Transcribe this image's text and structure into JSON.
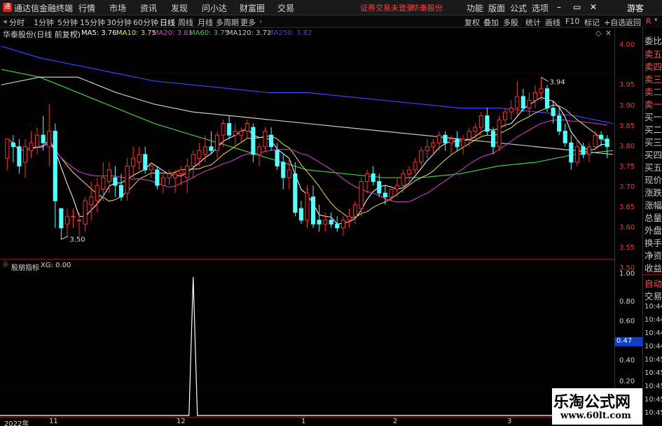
{
  "menubar": {
    "app_title": "通达信金融终端",
    "menu": [
      "行情",
      "市场",
      "资讯",
      "发现",
      "问小达",
      "财富圈",
      "交易"
    ],
    "notice": "证券交易未登录",
    "stock": "华泰股份",
    "right_menu": [
      "功能",
      "版面",
      "公式",
      "选项"
    ],
    "guest": "游客",
    "window_icons": [
      "minimize-icon",
      "restore-icon",
      "close-icon"
    ]
  },
  "period_bar": {
    "items": [
      "分时",
      "1分钟",
      "5分钟",
      "15分钟",
      "30分钟",
      "60分钟",
      "日线",
      "周线",
      "月线",
      "多周期",
      "更多"
    ],
    "active": "日线",
    "tools": [
      "复权",
      "叠加",
      "多股",
      "统计",
      "画线",
      "F10",
      "标记",
      "+自选",
      "返回"
    ]
  },
  "chart_header": {
    "title": "华泰股份(日线 前复权)",
    "ma": [
      {
        "label": "MA5: 3.76",
        "color": "#ffffff"
      },
      {
        "label": "MA10: 3.75",
        "color": "#f0e060"
      },
      {
        "label": "MA20: 3.81",
        "color": "#e040e0"
      },
      {
        "label": "MA60: 3.75",
        "color": "#40d040"
      },
      {
        "label": "MA120: 3.72",
        "color": "#c8c8c8"
      },
      {
        "label": "MA250: 3.82",
        "color": "#4040ff"
      }
    ]
  },
  "price_axis": [
    "4.00",
    "3.95",
    "3.90",
    "3.85",
    "3.80",
    "3.75",
    "3.70",
    "3.65",
    "3.60",
    "3.55",
    "3.50"
  ],
  "annotations": {
    "high": "3.94",
    "low": "3.50"
  },
  "indicator": {
    "title": "股朋指标",
    "value": "XG: 0.00",
    "axis": [
      "1.00",
      "0.80",
      "0.60",
      "0.40",
      "0.20"
    ],
    "marker": "0.47",
    "times": [
      "10:44",
      "10:44",
      "10:44",
      "10:44",
      "10:45",
      "10:45",
      "10:45",
      "10:45",
      "10:45",
      "10:45"
    ]
  },
  "date_axis": [
    "2022年",
    "11",
    "12",
    "1",
    "2",
    "3"
  ],
  "side_panel": {
    "labels": [
      "委比",
      "卖五",
      "卖四",
      "卖三",
      "卖二",
      "卖一",
      "买一",
      "买二",
      "买三",
      "买四",
      "买五",
      "现价",
      "涨跌",
      "涨幅",
      "总量",
      "外盘",
      "换手",
      "净资",
      "收益"
    ],
    "lower": [
      "自动",
      "交易"
    ]
  },
  "watermark": {
    "title": "乐淘公式网",
    "url": "www.60lt.com"
  },
  "chart_data": {
    "type": "candlestick",
    "title": "华泰股份(日线 前复权)",
    "ylim": [
      3.47,
      4.04
    ],
    "up_color": "#ff3030",
    "down_color": "#55ffff",
    "candles": [
      [
        3.73,
        3.78,
        3.7,
        3.78
      ],
      [
        3.77,
        3.79,
        3.72,
        3.76
      ],
      [
        3.76,
        3.78,
        3.69,
        3.71
      ],
      [
        3.72,
        3.78,
        3.68,
        3.76
      ],
      [
        3.75,
        3.8,
        3.73,
        3.77
      ],
      [
        3.76,
        3.81,
        3.74,
        3.79
      ],
      [
        3.79,
        3.84,
        3.75,
        3.77
      ],
      [
        3.76,
        3.87,
        3.71,
        3.8
      ],
      [
        3.8,
        3.82,
        3.55,
        3.62
      ],
      [
        3.6,
        3.6,
        3.52,
        3.55
      ],
      [
        3.56,
        3.6,
        3.53,
        3.58
      ],
      [
        3.58,
        3.6,
        3.55,
        3.58
      ],
      [
        3.57,
        3.59,
        3.53,
        3.57
      ],
      [
        3.56,
        3.63,
        3.54,
        3.62
      ],
      [
        3.61,
        3.67,
        3.57,
        3.63
      ],
      [
        3.62,
        3.68,
        3.59,
        3.66
      ],
      [
        3.65,
        3.72,
        3.62,
        3.68
      ],
      [
        3.67,
        3.72,
        3.64,
        3.7
      ],
      [
        3.68,
        3.71,
        3.63,
        3.66
      ],
      [
        3.66,
        3.69,
        3.62,
        3.63
      ],
      [
        3.64,
        3.73,
        3.62,
        3.71
      ],
      [
        3.71,
        3.76,
        3.68,
        3.73
      ],
      [
        3.72,
        3.76,
        3.7,
        3.74
      ],
      [
        3.74,
        3.76,
        3.69,
        3.7
      ],
      [
        3.7,
        3.72,
        3.68,
        3.71
      ],
      [
        3.7,
        3.71,
        3.65,
        3.66
      ],
      [
        3.66,
        3.69,
        3.64,
        3.68
      ],
      [
        3.68,
        3.7,
        3.66,
        3.69
      ],
      [
        3.68,
        3.7,
        3.64,
        3.69
      ],
      [
        3.69,
        3.71,
        3.66,
        3.7
      ],
      [
        3.68,
        3.73,
        3.64,
        3.71
      ],
      [
        3.71,
        3.75,
        3.68,
        3.74
      ],
      [
        3.73,
        3.77,
        3.71,
        3.75
      ],
      [
        3.74,
        3.79,
        3.72,
        3.76
      ],
      [
        3.76,
        3.8,
        3.74,
        3.75
      ],
      [
        3.75,
        3.8,
        3.73,
        3.79
      ],
      [
        3.79,
        3.83,
        3.76,
        3.82
      ],
      [
        3.82,
        3.84,
        3.78,
        3.79
      ],
      [
        3.79,
        3.82,
        3.76,
        3.8
      ],
      [
        3.79,
        3.81,
        3.77,
        3.8
      ],
      [
        3.8,
        3.83,
        3.78,
        3.82
      ],
      [
        3.81,
        3.82,
        3.72,
        3.74
      ],
      [
        3.74,
        3.77,
        3.71,
        3.76
      ],
      [
        3.76,
        3.81,
        3.75,
        3.8
      ],
      [
        3.79,
        3.81,
        3.75,
        3.76
      ],
      [
        3.75,
        3.77,
        3.7,
        3.71
      ],
      [
        3.72,
        3.74,
        3.65,
        3.68
      ],
      [
        3.68,
        3.73,
        3.65,
        3.7
      ],
      [
        3.69,
        3.72,
        3.58,
        3.59
      ],
      [
        3.6,
        3.62,
        3.56,
        3.57
      ],
      [
        3.57,
        3.66,
        3.55,
        3.64
      ],
      [
        3.63,
        3.66,
        3.55,
        3.56
      ],
      [
        3.57,
        3.61,
        3.54,
        3.56
      ],
      [
        3.56,
        3.59,
        3.54,
        3.57
      ],
      [
        3.57,
        3.59,
        3.55,
        3.56
      ],
      [
        3.56,
        3.58,
        3.54,
        3.55
      ],
      [
        3.55,
        3.58,
        3.53,
        3.57
      ],
      [
        3.57,
        3.6,
        3.55,
        3.58
      ],
      [
        3.58,
        3.62,
        3.56,
        3.61
      ],
      [
        3.6,
        3.68,
        3.58,
        3.67
      ],
      [
        3.67,
        3.7,
        3.64,
        3.69
      ],
      [
        3.69,
        3.71,
        3.66,
        3.67
      ],
      [
        3.67,
        3.69,
        3.63,
        3.64
      ],
      [
        3.64,
        3.66,
        3.61,
        3.63
      ],
      [
        3.63,
        3.65,
        3.62,
        3.65
      ],
      [
        3.65,
        3.68,
        3.63,
        3.66
      ],
      [
        3.66,
        3.7,
        3.64,
        3.69
      ],
      [
        3.69,
        3.71,
        3.67,
        3.7
      ],
      [
        3.7,
        3.73,
        3.69,
        3.72
      ],
      [
        3.72,
        3.76,
        3.71,
        3.75
      ],
      [
        3.75,
        3.78,
        3.73,
        3.76
      ],
      [
        3.76,
        3.78,
        3.74,
        3.77
      ],
      [
        3.77,
        3.8,
        3.75,
        3.79
      ],
      [
        3.79,
        3.8,
        3.75,
        3.77
      ],
      [
        3.77,
        3.79,
        3.74,
        3.78
      ],
      [
        3.78,
        3.8,
        3.75,
        3.76
      ],
      [
        3.76,
        3.79,
        3.74,
        3.78
      ],
      [
        3.78,
        3.81,
        3.76,
        3.8
      ],
      [
        3.8,
        3.82,
        3.78,
        3.81
      ],
      [
        3.81,
        3.85,
        3.79,
        3.84
      ],
      [
        3.84,
        3.86,
        3.79,
        3.8
      ],
      [
        3.8,
        3.81,
        3.74,
        3.76
      ],
      [
        3.76,
        3.84,
        3.75,
        3.83
      ],
      [
        3.83,
        3.86,
        3.81,
        3.85
      ],
      [
        3.85,
        3.88,
        3.83,
        3.86
      ],
      [
        3.86,
        3.93,
        3.84,
        3.89
      ],
      [
        3.89,
        3.91,
        3.85,
        3.86
      ],
      [
        3.86,
        3.9,
        3.84,
        3.88
      ],
      [
        3.88,
        3.92,
        3.86,
        3.9
      ],
      [
        3.9,
        3.94,
        3.88,
        3.91
      ],
      [
        3.91,
        3.92,
        3.85,
        3.86
      ],
      [
        3.86,
        3.88,
        3.82,
        3.84
      ],
      [
        3.84,
        3.86,
        3.79,
        3.8
      ],
      [
        3.8,
        3.82,
        3.76,
        3.77
      ],
      [
        3.77,
        3.79,
        3.7,
        3.72
      ],
      [
        3.72,
        3.78,
        3.71,
        3.76
      ],
      [
        3.76,
        3.77,
        3.73,
        3.74
      ],
      [
        3.74,
        3.77,
        3.72,
        3.76
      ],
      [
        3.76,
        3.8,
        3.75,
        3.79
      ],
      [
        3.79,
        3.8,
        3.76,
        3.78
      ],
      [
        3.78,
        3.79,
        3.73,
        3.76
      ]
    ],
    "ma_series": [
      {
        "name": "MA5",
        "color": "#ffffff"
      },
      {
        "name": "MA10",
        "color": "#f0e060"
      },
      {
        "name": "MA20",
        "color": "#e040e0"
      },
      {
        "name": "MA60",
        "color": "#40d040",
        "values": [
          3.96,
          3.94,
          3.9,
          3.86,
          3.82,
          3.79,
          3.76,
          3.73,
          3.7,
          3.69,
          3.68,
          3.68,
          3.69,
          3.71,
          3.72,
          3.74,
          3.75
        ]
      },
      {
        "name": "MA120",
        "color": "#c8c8c8",
        "values": [
          3.92,
          3.94,
          3.94,
          3.9,
          3.87,
          3.85,
          3.84,
          3.83,
          3.82,
          3.81,
          3.8,
          3.79,
          3.78,
          3.77,
          3.76,
          3.75,
          3.74
        ]
      },
      {
        "name": "MA250",
        "color": "#4040ff",
        "values": [
          4.02,
          3.99,
          3.97,
          3.95,
          3.93,
          3.92,
          3.91,
          3.9,
          3.9,
          3.89,
          3.88,
          3.87,
          3.86,
          3.86,
          3.85,
          3.84,
          3.82
        ]
      }
    ],
    "indicator_series": {
      "name": "XG",
      "spike_index": 31,
      "value": 1.0
    }
  }
}
